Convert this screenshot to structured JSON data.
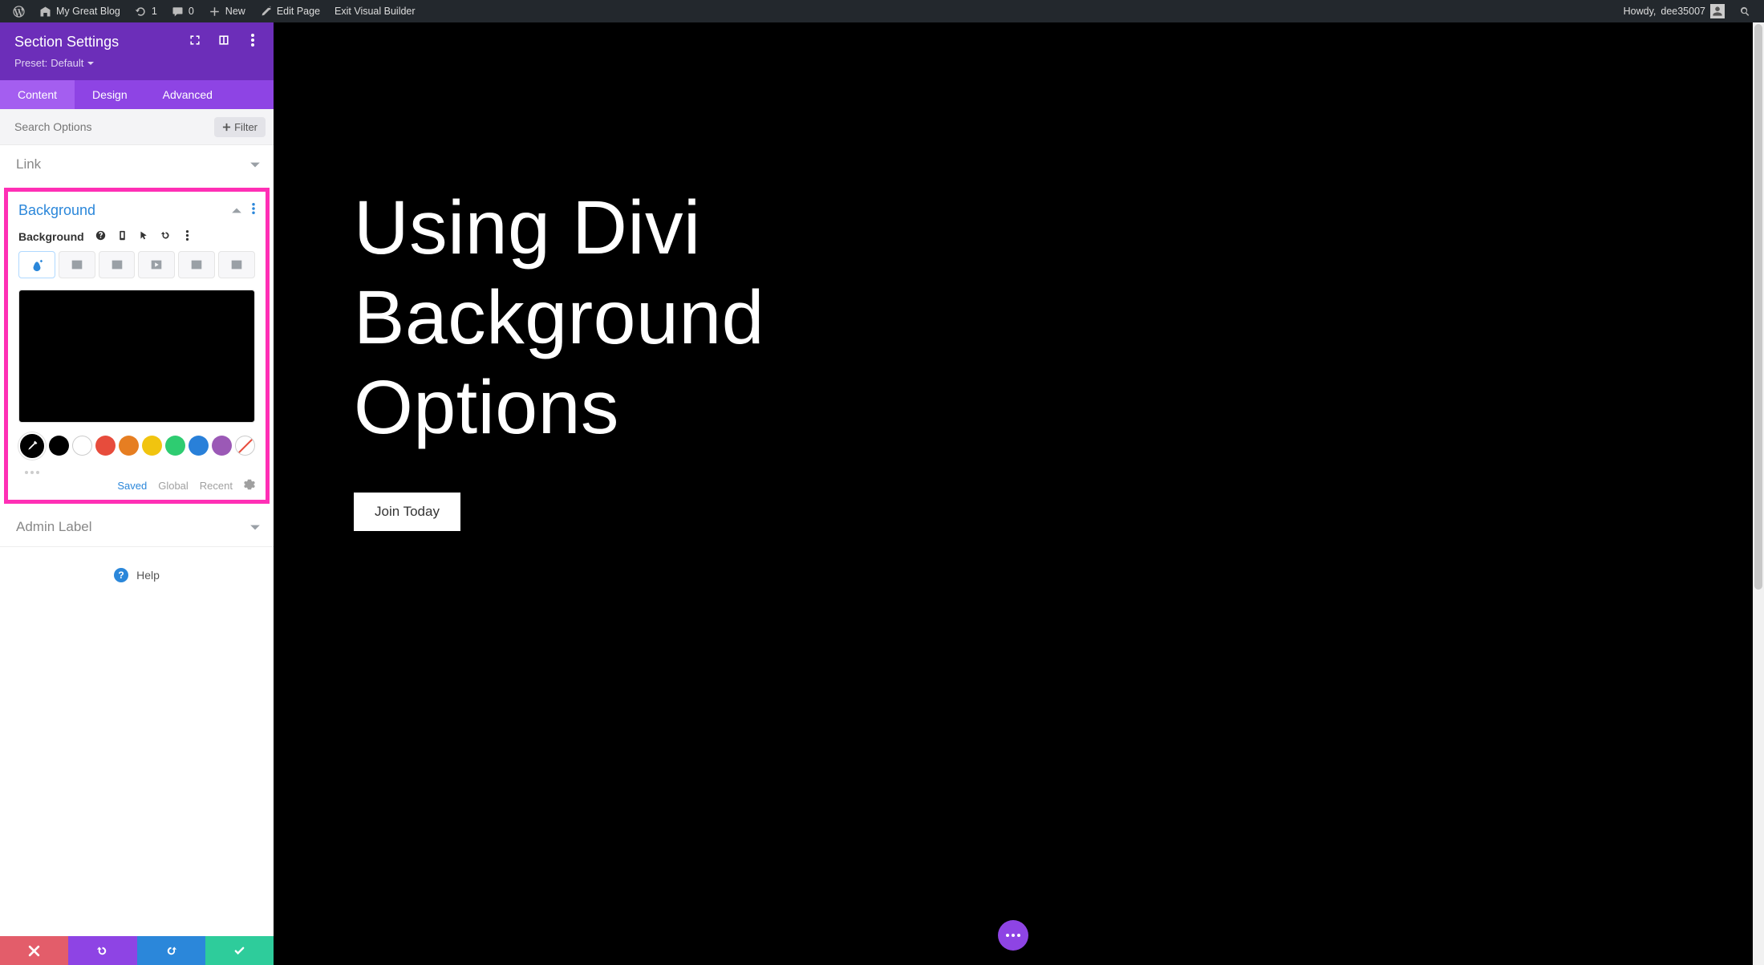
{
  "wp_bar": {
    "site_name": "My Great Blog",
    "refresh_count": "1",
    "comments_count": "0",
    "new_label": "New",
    "edit_page": "Edit Page",
    "exit_vb": "Exit Visual Builder",
    "howdy_prefix": "Howdy,",
    "user": "dee35007"
  },
  "sidebar": {
    "title": "Section Settings",
    "preset_label": "Preset:",
    "preset_value": "Default",
    "tabs": {
      "content": "Content",
      "design": "Design",
      "advanced": "Advanced"
    },
    "search_placeholder": "Search Options",
    "filter_label": "Filter",
    "groups": {
      "link": "Link",
      "background": "Background",
      "admin_label": "Admin Label"
    },
    "background_field_label": "Background",
    "palette": {
      "eyedropper": "eyedropper",
      "colors": [
        "#000000",
        "#ffffff",
        "#e74c3c",
        "#e67e22",
        "#f1c40f",
        "#2ecc71",
        "#2980d9",
        "#9b59b6"
      ],
      "tabs": {
        "saved": "Saved",
        "global": "Global",
        "recent": "Recent"
      }
    },
    "help": "Help"
  },
  "page": {
    "hero_title_line1": "Using Divi",
    "hero_title_line2": "Background",
    "hero_title_line3": "Options",
    "cta": "Join Today"
  },
  "colors": {
    "accent_purple": "#8e44e4",
    "accent_blue": "#2b87da",
    "highlight_pink": "#ff2fb5"
  }
}
